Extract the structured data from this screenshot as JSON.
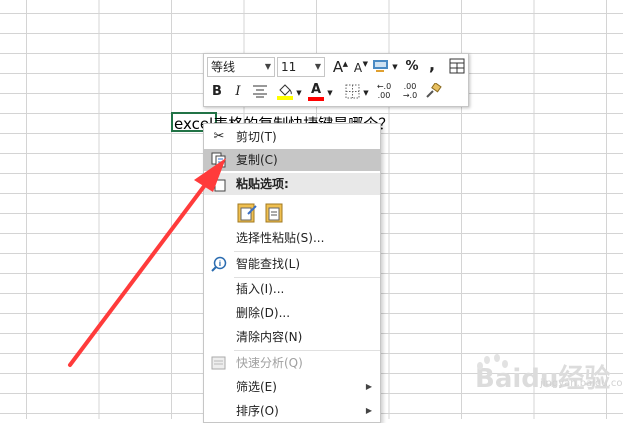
{
  "sheet": {
    "cell_text": "excel表格的复制快捷键是哪个？"
  },
  "mini_toolbar": {
    "font_name": "等线",
    "font_size": "11",
    "grow_font": "A",
    "shrink_font": "A",
    "percent": "%",
    "comma": ",",
    "bold": "B",
    "italic": "I",
    "fill_color": "#ffff00",
    "font_color": "#ff0000",
    "font_color_letter": "A",
    "increase_decimal_top": "←.0",
    "increase_decimal_bottom": ".00",
    "decrease_decimal_top": ".00",
    "decrease_decimal_bottom": "→.0"
  },
  "context_menu": {
    "cut": "剪切(T)",
    "copy": "复制(C)",
    "paste_options": "粘贴选项:",
    "paste_special": "选择性粘贴(S)...",
    "smart_lookup": "智能查找(L)",
    "insert": "插入(I)...",
    "delete": "删除(D)...",
    "clear_contents": "清除内容(N)",
    "quick_analysis": "快速分析(Q)",
    "filter": "筛选(E)",
    "sort": "排序(O)"
  },
  "watermark": {
    "logo_text": "Baidu经验",
    "sub_text": "jingyan.baidu.com"
  },
  "colors": {
    "arrow": "#ff3b3b",
    "selection_border": "#217346",
    "menu_highlight": "#c6c6c6"
  }
}
